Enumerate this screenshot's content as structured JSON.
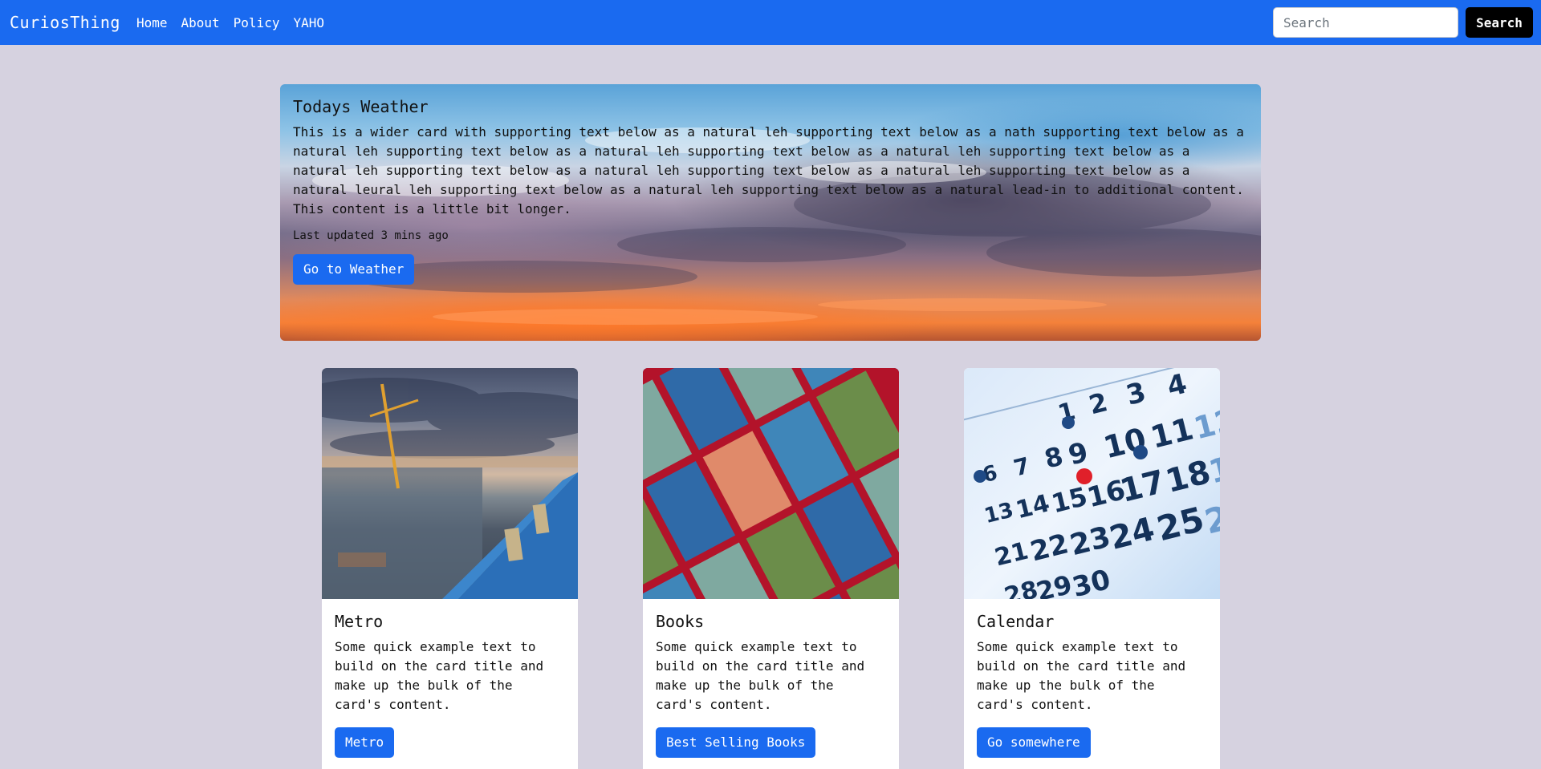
{
  "navbar": {
    "brand": "CuriosThing",
    "links": [
      "Home",
      "About",
      "Policy",
      "YAHO"
    ],
    "search_placeholder": "Search",
    "search_button": "Search",
    "color": "#1a6af0"
  },
  "hero": {
    "title": "Todays Weather",
    "text": "This is a wider card with supporting text below as a natural leh supporting text below as a nath supporting text below as a natural leh supporting text below as a natural leh supporting text below as a natural leh supporting text below as a natural leh supporting text below as a natural leh supporting text below as a natural leh supporting text below as a natural leural leh supporting text below as a natural leh supporting text below as a natural lead-in to additional content. This content is a little bit longer.",
    "updated": "Last updated 3 mins ago",
    "button": "Go to Weather"
  },
  "cards": [
    {
      "title": "Metro",
      "text": "Some quick example text to build on the card title and make up the bulk of the card's content.",
      "button": "Metro",
      "image_icon": "metro-photo"
    },
    {
      "title": "Books",
      "text": "Some quick example text to build on the card title and make up the bulk of the card's content.",
      "button": "Best Selling Books",
      "image_icon": "books-photo"
    },
    {
      "title": "Calendar",
      "text": "Some quick example text to build on the card title and make up the bulk of the card's content.",
      "button": "Go somewhere",
      "image_icon": "calendar-photo"
    }
  ]
}
